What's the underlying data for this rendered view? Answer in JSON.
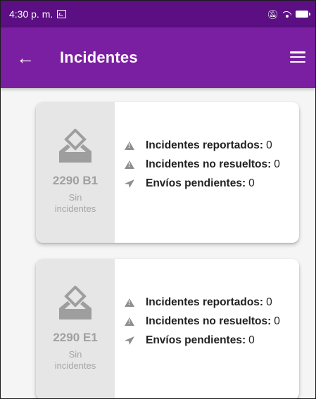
{
  "status_bar": {
    "time": "4:30 p. m."
  },
  "app_bar": {
    "title": "Incidentes"
  },
  "colors": {
    "status_bar": "#5b0f82",
    "app_bar": "#7b1fa2",
    "card_left_bg": "#e6e6e6",
    "icon_gray": "#8e8e8e"
  },
  "icons": {
    "back": "arrow-left-icon",
    "menu": "hamburger-menu-icon",
    "box": "ballot-box-icon",
    "warning": "warning-icon",
    "send": "send-icon"
  },
  "cards": [
    {
      "code": "2290 B1",
      "status": "Sin incidentes",
      "rows": [
        {
          "label": "Incidentes reportados:",
          "value": "0"
        },
        {
          "label": "Incidentes no resueltos:",
          "value": "0"
        },
        {
          "label": "Envíos pendientes:",
          "value": "0"
        }
      ]
    },
    {
      "code": "2290 E1",
      "status": "Sin incidentes",
      "rows": [
        {
          "label": "Incidentes reportados:",
          "value": "0"
        },
        {
          "label": "Incidentes no resueltos:",
          "value": "0"
        },
        {
          "label": "Envíos pendientes:",
          "value": "0"
        }
      ]
    }
  ]
}
